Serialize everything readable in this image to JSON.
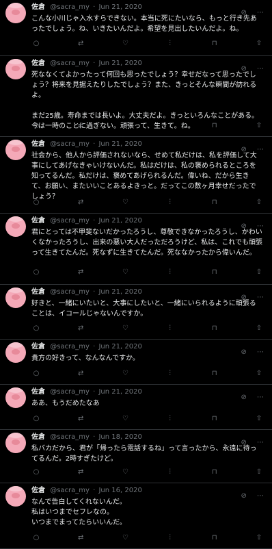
{
  "tweets": [
    {
      "name": "佐倉",
      "handle": "@sacra_my",
      "date": "Jun 21, 2020",
      "text": "こんな小川じゃ入水すらできない。本当に死にたいなら、もっと行き先あったでしょう。ね、いきたいんだよ。希望を見出したいんだよ。ね。"
    },
    {
      "name": "佐倉",
      "handle": "@sacra_my",
      "date": "Jun 21, 2020",
      "text": "死ななくてよかったって何回も思ったでしょう？幸せだなって思ったでしょう？将来を見据えたりしたでしょう？また、きっとそんな瞬間が訪れるよ。\n\nまだ25歳。寿命までは長いよ。大丈夫だよ。きっといろんなことがある。今は一時のことに過ぎない。頑張って、生きて。ね。"
    },
    {
      "name": "佐倉",
      "handle": "@sacra_my",
      "date": "Jun 21, 2020",
      "text": "社会から、他人から評価されないなら、せめて私だけは、私を評価して大事にしてあげなきゃいけないんだ。私はだけは、私の褒められるところを知ってるんだ。私だけは、褒めてあげられるんだ。偉いね、だから生きて、お願い、またいいことあるよきっと。だってこの数ヶ月幸せだったでしょう？"
    },
    {
      "name": "佐倉",
      "handle": "@sacra_my",
      "date": "Jun 21, 2020",
      "text": "君にとっては不甲斐ないだかったろうし、尊敬できなかったろうし、かわいくなかったろうし、出来の悪い大人だっただろうけど、私は、これでも頑張って生きてたんだ。死なずに生きてたんだ。死ななかったから偉いんだ。"
    },
    {
      "name": "佐倉",
      "handle": "@sacra_my",
      "date": "Jun 21, 2020",
      "text": "好きと、一緒にいたいと、大事にしたいと、一緒にいられるように頑張ることは、イコールじゃないんですか。"
    },
    {
      "name": "佐倉",
      "handle": "@sacra_my",
      "date": "Jun 21, 2020",
      "text": "貴方の好きって、なんなんですか。"
    },
    {
      "name": "佐倉",
      "handle": "@sacra_my",
      "date": "Jun 21, 2020",
      "text": "ああ、もうだめたなあ"
    },
    {
      "name": "佐倉",
      "handle": "@sacra_my",
      "date": "Jun 18, 2020",
      "text": "私バカだから、君が「帰ったら電話するね」って言ったから、永遠に待ってるんだ。2時すぎたけど。"
    },
    {
      "name": "佐倉",
      "handle": "@sacra_my",
      "date": "Jun 16, 2020",
      "text": "なんで告白してくれないんだ。\n私はいつまでセフレなの。\nいつまでまってたらいいんだ。"
    }
  ],
  "icons": {
    "dot": "·",
    "grok": "⊘",
    "more": "⋯",
    "reply": "○",
    "retweet": "⇄",
    "like": "♡",
    "views": "⫶",
    "bookmark": "⊓",
    "share": "⇧"
  },
  "colors": {
    "background": "#000000",
    "text": "#e7e9ea",
    "muted": "#71767b",
    "avatar": "#f4a9b8"
  }
}
